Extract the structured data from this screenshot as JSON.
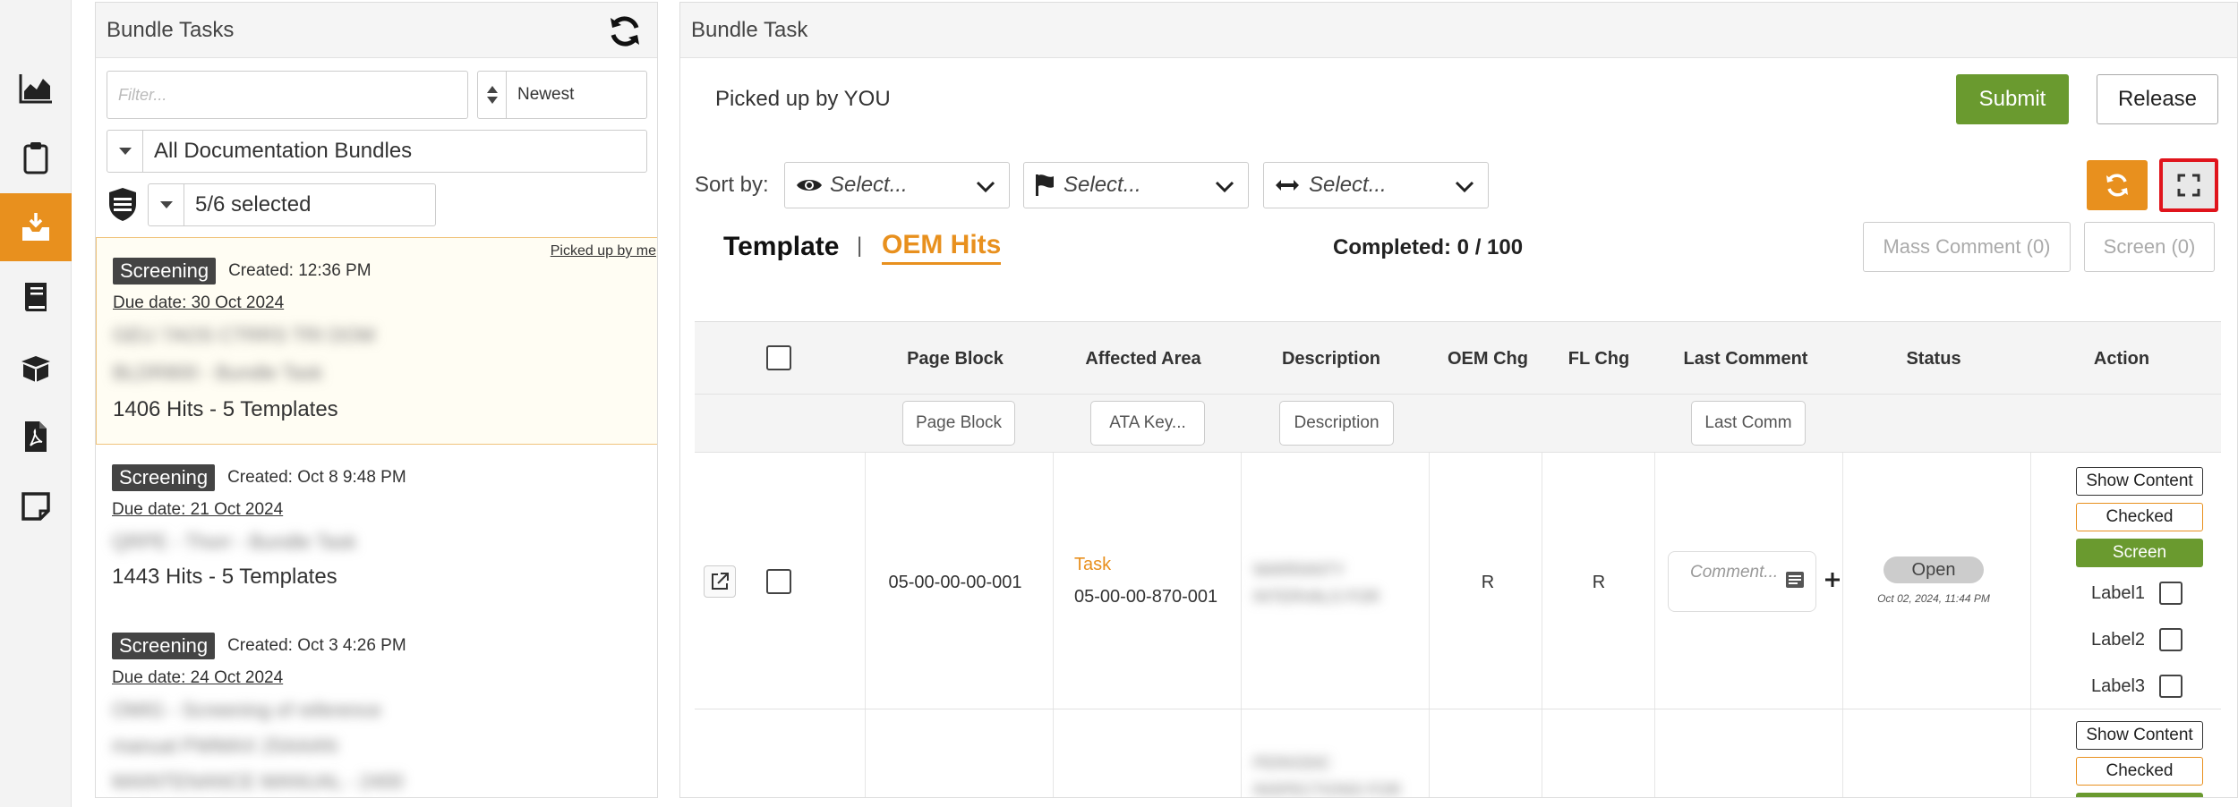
{
  "nav": {
    "items": [
      {
        "icon": "area-chart-icon"
      },
      {
        "icon": "clipboard-icon"
      },
      {
        "icon": "inbox-download-icon",
        "active": true
      },
      {
        "icon": "book-icon"
      },
      {
        "icon": "open-box-icon"
      },
      {
        "icon": "pdf-file-icon"
      },
      {
        "icon": "sticky-note-icon"
      }
    ],
    "accent": "#e8901e"
  },
  "bundle_tasks": {
    "title": "Bundle Tasks",
    "filter_placeholder": "Filter...",
    "sort_value": "Newest",
    "bundle_select": "All Documentation Bundles",
    "selected_count": "5/6 selected",
    "cards": [
      {
        "badge": "Screening",
        "created": "Created: 12:36 PM",
        "due": "Due date: 30 Oct 2024",
        "picked": "Picked up by me",
        "blur_lines": [
          "GEU 7AOS CTRRS TRI DOM",
          "BLDR800 - Bundle Task"
        ],
        "hits": "1406 Hits - 5 Templates"
      },
      {
        "badge": "Screening",
        "created": "Created: Oct 8 9:48 PM",
        "due": "Due date: 21 Oct 2024",
        "blur_lines": [
          "QRPE - Thorr - Bundle Task"
        ],
        "hits": "1443 Hits - 5 Templates"
      },
      {
        "badge": "Screening",
        "created": "Created: Oct 3 4:26 PM",
        "due": "Due date: 24 Oct 2024",
        "blur_lines": [
          "OMIG - Screening of reference",
          "manual PWMAX 25AAAN",
          "MAINTENANCE MANUAL - 2400"
        ]
      }
    ]
  },
  "bundle_task": {
    "title": "Bundle Task",
    "picked_up": "Picked up by YOU",
    "submit": "Submit",
    "release": "Release",
    "sort_by": "Sort by:",
    "sort_selects": [
      "Select...",
      "Select...",
      "Select..."
    ],
    "tab_template": "Template",
    "tab_sep": "|",
    "tab_oem": "OEM Hits",
    "completed_label": "Completed:",
    "completed_value": "0 / 100",
    "mass_comment": "Mass Comment (0)",
    "screen_btn": "Screen (0)",
    "colors": {
      "submit": "#6a9a2f",
      "orange": "#e8901e",
      "highlight": "#e0141c"
    }
  },
  "table": {
    "headers": [
      "Page Block",
      "Affected Area",
      "Description",
      "OEM Chg",
      "FL Chg",
      "Last Comment",
      "Status",
      "Action"
    ],
    "filters": [
      "Page Block",
      "ATA Key...",
      "Description",
      "Last Comm"
    ],
    "rows": [
      {
        "page_block": "05-00-00-00-001",
        "area_type": "Task",
        "area_code": "05-00-00-870-001",
        "description": "WARRANTY INTERVALS FOR",
        "oem_chg": "R",
        "fl_chg": "R",
        "comment_placeholder": "Comment...",
        "status": "Open",
        "status_date": "Oct 02, 2024, 11:44 PM",
        "actions": [
          "Show Content",
          "Checked",
          "Screen"
        ],
        "labels": [
          "Label1",
          "Label2",
          "Label3"
        ]
      },
      {
        "description": "PERIODIC INSPECTIONS FOR",
        "actions": [
          "Show Content",
          "Checked"
        ]
      }
    ]
  }
}
